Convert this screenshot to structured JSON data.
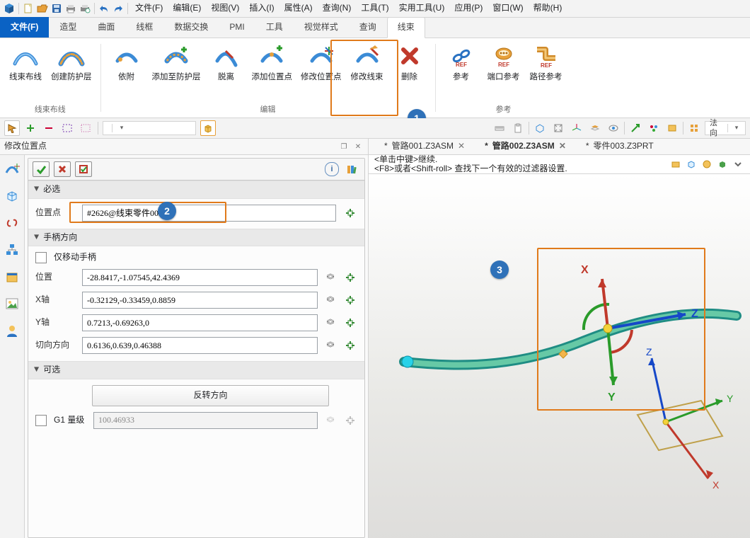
{
  "menus": {
    "file": "文件(F)",
    "edit": "编辑(E)",
    "view": "视图(V)",
    "insert": "插入(I)",
    "attrs": "属性(A)",
    "query": "查询(N)",
    "tools": "工具(T)",
    "utilities": "实用工具(U)",
    "app": "应用(P)",
    "window": "窗口(W)",
    "help": "帮助(H)"
  },
  "ribbon_tabs": {
    "file": "文件(F)",
    "shape": "造型",
    "surface": "曲面",
    "wireframe": "线框",
    "data_exch": "数据交换",
    "pmi": "PMI",
    "tool": "工具",
    "visual": "视觉样式",
    "qry": "查询",
    "harness": "线束"
  },
  "ribbon": {
    "groups": {
      "layout": {
        "route": "线束布线",
        "create_shield": "创建防护层",
        "title": "线束布线"
      },
      "edit": {
        "attach": "依附",
        "add_to_shield": "添加至防护层",
        "detach": "脱离",
        "add_pos": "添加位置点",
        "mod_pos": "修改位置点",
        "mod_harness": "修改线束",
        "delete": "删除",
        "title": "编辑"
      },
      "ref": {
        "ref": "参考",
        "port_ref": "端口参考",
        "path_ref": "路径参考",
        "title": "参考"
      }
    }
  },
  "callouts": {
    "c1": "1",
    "c2": "2",
    "c3": "3"
  },
  "panel": {
    "title": "修改位置点"
  },
  "sections": {
    "required": "必选",
    "handle": "手柄方向",
    "optional": "可选"
  },
  "fields": {
    "pos_point_label": "位置点",
    "pos_point_value": "#2626@线束零件002_1",
    "only_move_handle": "仅移动手柄",
    "position_label": "位置",
    "position_value": "-28.8417,-1.07545,42.4369",
    "xaxis_label": "X轴",
    "xaxis_value": "-0.32129,-0.33459,0.8859",
    "yaxis_label": "Y轴",
    "yaxis_value": "0.7213,-0.69263,0",
    "tangent_label": "切向方向",
    "tangent_value": "0.6136,0.639,0.46388",
    "reverse_btn": "反转方向",
    "g1_label": "G1 量级",
    "g1_value": "100.46933"
  },
  "docs": {
    "t1": "管路001.Z3ASM",
    "t2": "管路002.Z3ASM",
    "t3": "零件003.Z3PRT"
  },
  "viewport_hints": {
    "line1": "<单击中键>继续.",
    "line2": "<F8>或者<Shift-roll> 查找下一个有效的过滤器设置."
  },
  "axes": {
    "X": "X",
    "Y": "Y",
    "Z": "Z"
  },
  "toolstrip": {
    "filter_dd": "",
    "normal": "法向"
  },
  "icon_names": {
    "info": "i",
    "books": "📚"
  }
}
